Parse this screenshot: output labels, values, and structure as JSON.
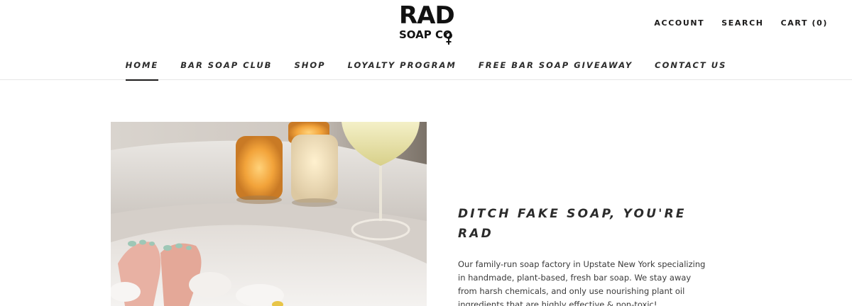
{
  "brand": {
    "logo_main": "RAD",
    "logo_sub": "SOAP CO"
  },
  "header": {
    "account": "ACCOUNT",
    "search": "SEARCH",
    "cart": "CART (0)"
  },
  "nav": {
    "items": [
      {
        "label": "HOME",
        "active": true
      },
      {
        "label": "BAR SOAP CLUB"
      },
      {
        "label": "SHOP"
      },
      {
        "label": "LOYALTY PROGRAM"
      },
      {
        "label": "FREE BAR SOAP GIVEAWAY"
      },
      {
        "label": "CONTACT US"
      }
    ]
  },
  "hero": {
    "heading": "DITCH FAKE SOAP, YOU'RE RAD",
    "body": "Our family-run soap factory in Upstate New York specializing in handmade, plant-based, fresh bar soap. We stay away from harsh chemicals, and only use nourishing plant oil ingredients that are highly effective & non-toxic!"
  },
  "colors": {
    "text": "#1c1b1b",
    "border": "#e6e6e6",
    "candle_glow": "#f2a33a"
  }
}
